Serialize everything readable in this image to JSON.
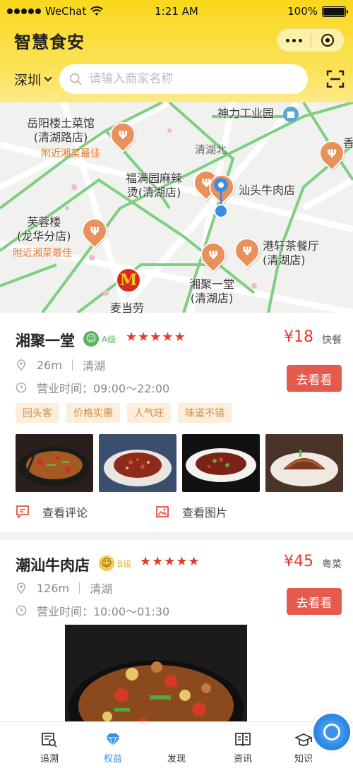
{
  "status_bar": {
    "carrier": "WeChat",
    "time": "1:21 AM",
    "battery": "100%",
    "battery_level": 1.0
  },
  "header": {
    "title": "智慧食安"
  },
  "search": {
    "city": "深圳",
    "placeholder": "请输入商家名称"
  },
  "map": {
    "labels": {
      "yueyang": "岳阳楼土菜馆\n(清湖路店)",
      "yueyang_sub": "附近湘菜最佳",
      "shenli": "神力工业园",
      "qinghubei": "清湖北",
      "fuman": "福满园麻辣\n烫(清湖店)",
      "shantou": "汕头牛肉店",
      "furong": "芙蓉楼\n(龙华分店)",
      "furong_sub": "附近湘菜最佳",
      "gangxuan": "港轩茶餐厅\n(清湖店)",
      "xiangju": "湘聚一堂\n(清湖店)",
      "mcd": "麦当劳",
      "edge": "香"
    }
  },
  "restaurants": [
    {
      "name": "湘聚一堂",
      "grade": "A级",
      "stars": "★★★★★",
      "price": "¥18",
      "type": "快餐",
      "distance": "26m",
      "area": "清湖",
      "hours": "营业时间：09:00～22:00",
      "button": "去看看",
      "tags": [
        "回头客",
        "价格实惠",
        "人气旺",
        "味道不错"
      ],
      "actions": {
        "reviews": "查看评论",
        "photos": "查看图片"
      }
    },
    {
      "name": "潮汕牛肉店",
      "grade": "B级",
      "stars": "★★★★★",
      "price": "¥45",
      "type": "粤菜",
      "distance": "126m",
      "area": "清湖",
      "hours": "营业时间：10:00～01:30",
      "button": "去看看"
    }
  ],
  "tabbar": {
    "tabs": [
      {
        "label": "追溯",
        "icon": "trace-icon"
      },
      {
        "label": "权益",
        "icon": "diamond-icon"
      },
      {
        "label": "发现",
        "icon": "discover-icon"
      },
      {
        "label": "资讯",
        "icon": "news-icon"
      },
      {
        "label": "知识",
        "icon": "graduation-cap-icon"
      }
    ],
    "active_index": 1
  },
  "colors": {
    "brand_yellow": "#f9d71c",
    "accent_red": "#e53b2e",
    "button_red": "#e65a4e",
    "tab_active": "#3a8ee6",
    "pin_orange": "#e8915a"
  }
}
